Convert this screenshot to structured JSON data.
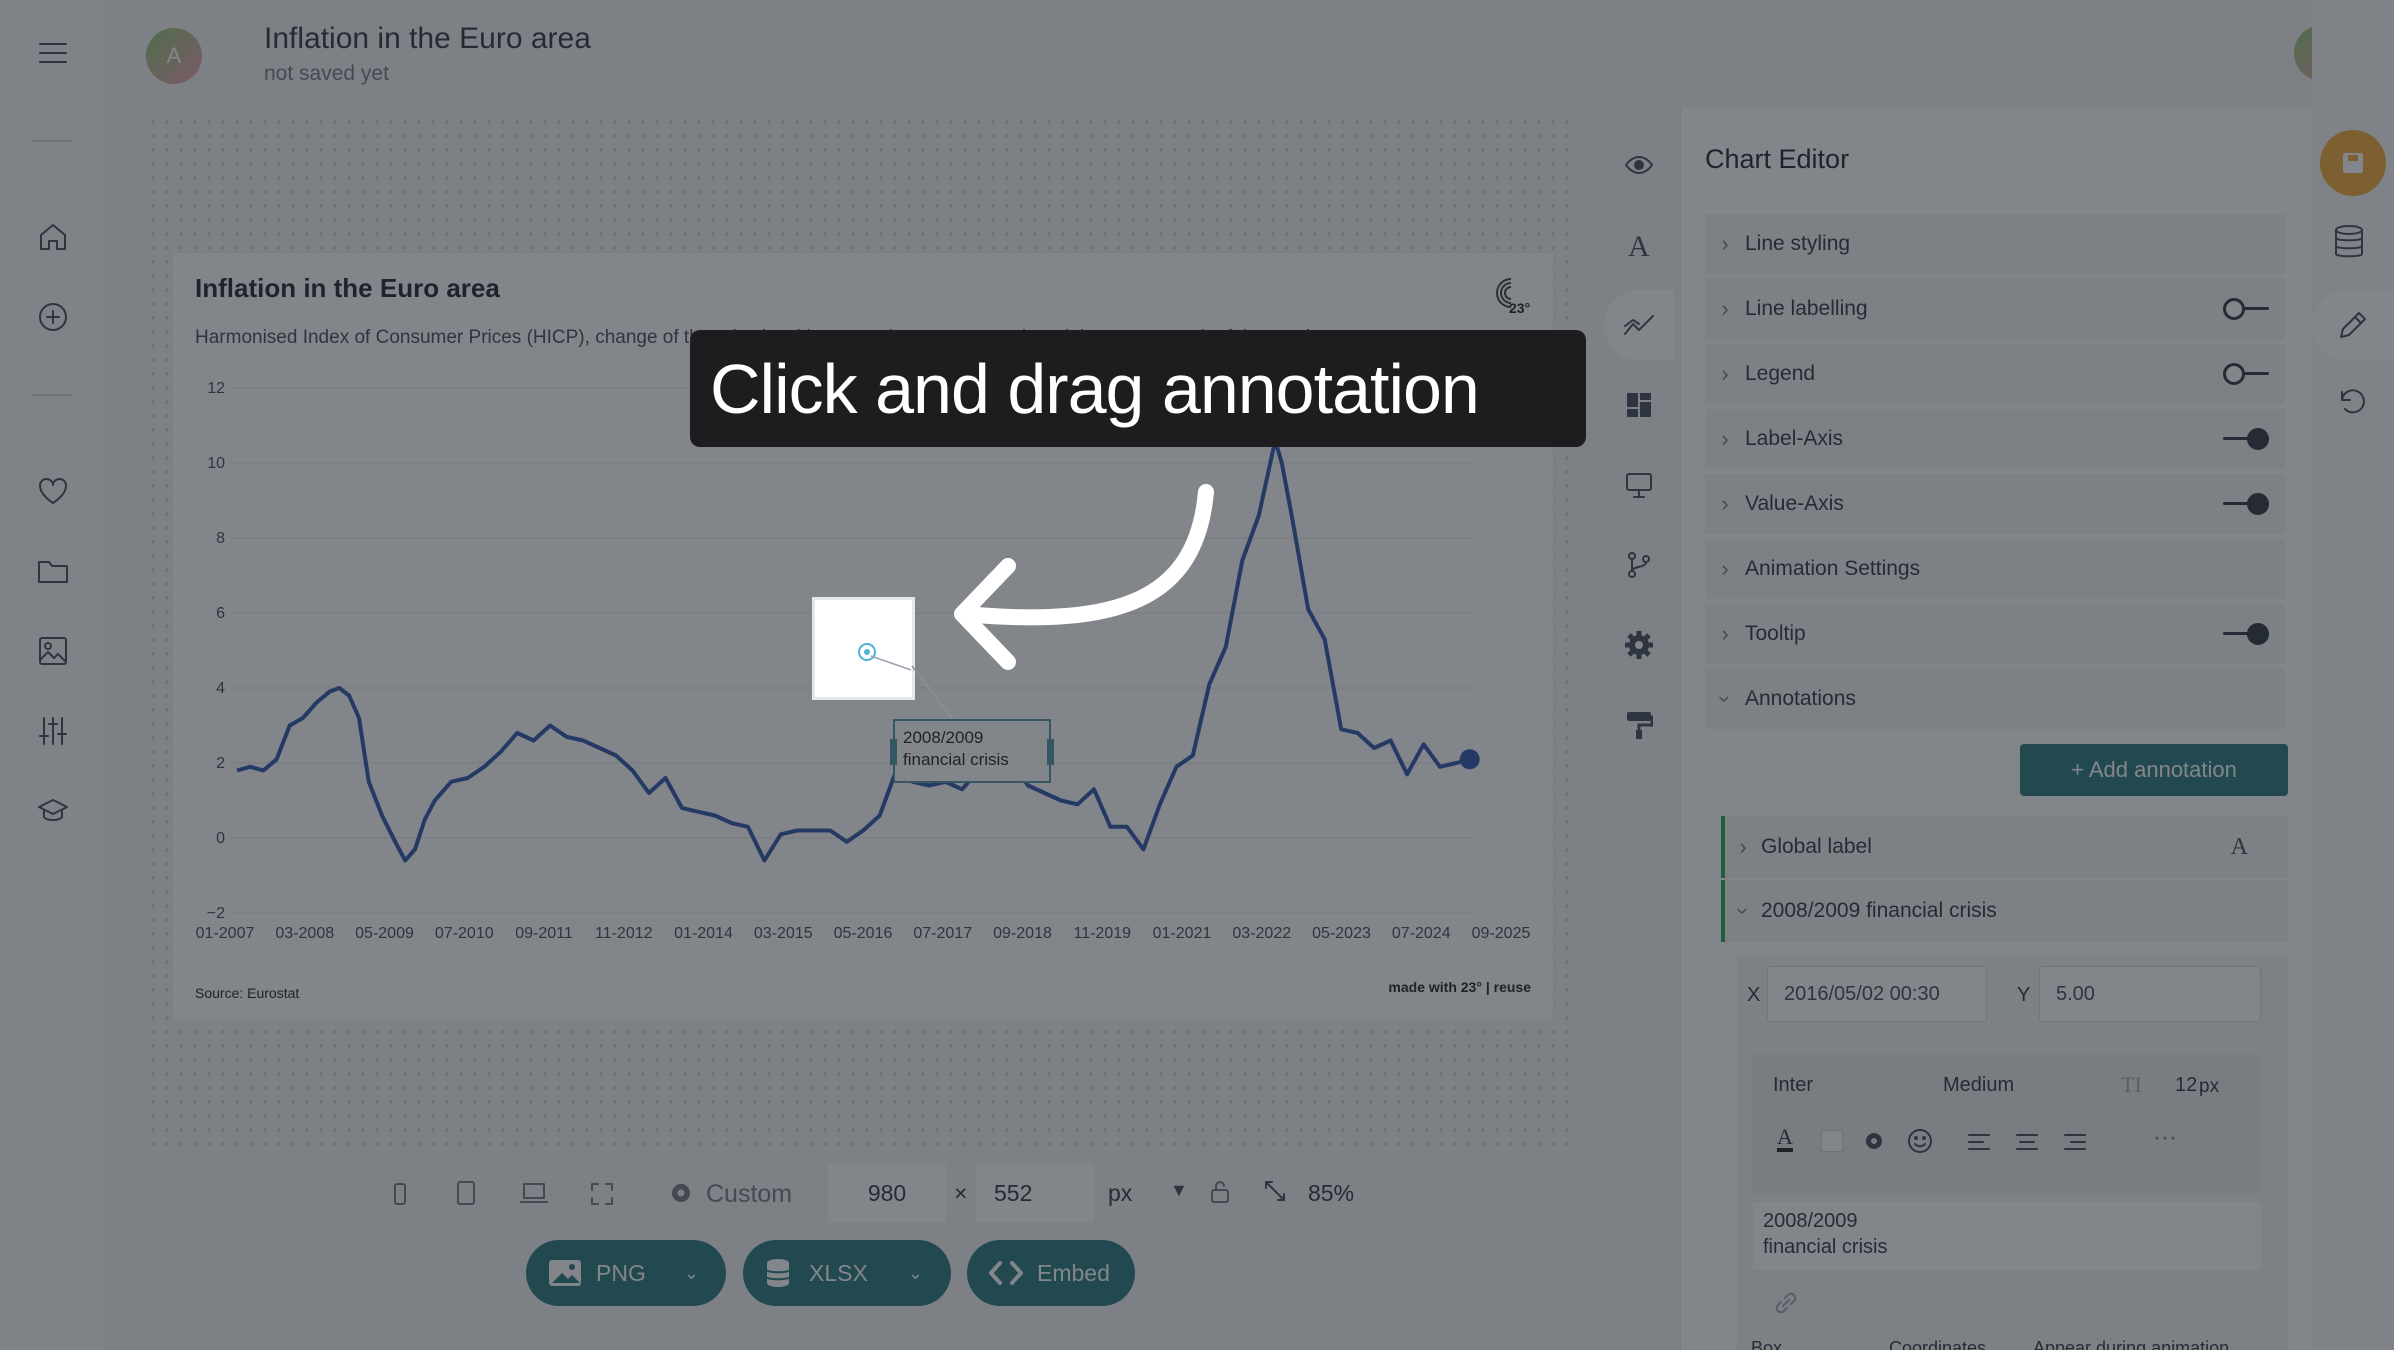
{
  "app": {
    "title": "Inflation in the Euro area",
    "subtitle": "not saved yet",
    "user_initial": "A"
  },
  "left_nav": {
    "items": [
      {
        "name": "menu-icon"
      },
      {
        "name": "home-icon"
      },
      {
        "name": "add-circle-icon"
      },
      {
        "name": "heart-icon"
      },
      {
        "name": "folder-icon"
      },
      {
        "name": "image-icon"
      },
      {
        "name": "sliders-icon"
      },
      {
        "name": "graduation-cap-icon"
      }
    ]
  },
  "chart": {
    "logo_text": "23°",
    "footer_source": "Source: Eurostat",
    "footer_credit": "made with 23° | reuse",
    "annotation_text_line1": "2008/2009",
    "annotation_text_line2": "financial crisis"
  },
  "chart_data": {
    "type": "line",
    "title": "Inflation in the Euro area",
    "subtitle": "Harmonised Index of Consumer Prices (HICP), change of the price level between the current month and the same month of the previous year",
    "xlabel": "",
    "ylabel": "",
    "ylim": [
      -2,
      12
    ],
    "yticks": [
      "12",
      "10",
      "8",
      "6",
      "4",
      "2",
      "0",
      "−2"
    ],
    "xticks": [
      "01-2007",
      "03-2008",
      "05-2009",
      "07-2010",
      "09-2011",
      "11-2012",
      "01-2014",
      "03-2015",
      "05-2016",
      "07-2017",
      "09-2018",
      "11-2019",
      "01-2021",
      "03-2022",
      "05-2023",
      "07-2024",
      "09-2025"
    ],
    "series": [
      {
        "color": "#1f4ea8",
        "x": [
          2007.0,
          2007.2,
          2007.4,
          2007.6,
          2007.8,
          2008.0,
          2008.2,
          2008.4,
          2008.55,
          2008.7,
          2008.85,
          2009.0,
          2009.2,
          2009.4,
          2009.55,
          2009.7,
          2009.85,
          2010.0,
          2010.25,
          2010.5,
          2010.75,
          2011.0,
          2011.25,
          2011.5,
          2011.75,
          2012.0,
          2012.25,
          2012.5,
          2012.75,
          2013.0,
          2013.25,
          2013.5,
          2013.75,
          2014.0,
          2014.25,
          2014.5,
          2014.75,
          2015.0,
          2015.25,
          2015.5,
          2015.75,
          2016.0,
          2016.25,
          2016.5,
          2016.75,
          2017.0,
          2017.25,
          2017.5,
          2017.75,
          2018.0,
          2018.25,
          2018.5,
          2018.75,
          2019.0,
          2019.25,
          2019.5,
          2019.75,
          2020.0,
          2020.25,
          2020.5,
          2020.75,
          2021.0,
          2021.25,
          2021.5,
          2021.75,
          2022.0,
          2022.25,
          2022.5,
          2022.75,
          2022.85,
          2023.0,
          2023.25,
          2023.5,
          2023.75,
          2024.0,
          2024.25,
          2024.5,
          2024.75,
          2025.0,
          2025.25,
          2025.5,
          2025.7
        ],
        "y": [
          1.8,
          1.9,
          1.8,
          2.1,
          3.0,
          3.2,
          3.6,
          3.9,
          4.0,
          3.8,
          3.2,
          1.5,
          0.6,
          -0.1,
          -0.6,
          -0.3,
          0.5,
          1.0,
          1.5,
          1.6,
          1.9,
          2.3,
          2.8,
          2.6,
          3.0,
          2.7,
          2.6,
          2.4,
          2.2,
          1.8,
          1.2,
          1.6,
          0.8,
          0.7,
          0.6,
          0.4,
          0.3,
          -0.6,
          0.1,
          0.2,
          0.2,
          0.2,
          -0.1,
          0.2,
          0.6,
          1.8,
          1.5,
          1.4,
          1.5,
          1.3,
          1.8,
          2.1,
          2.0,
          1.4,
          1.2,
          1.0,
          0.9,
          1.3,
          0.3,
          0.3,
          -0.3,
          0.9,
          1.9,
          2.2,
          4.1,
          5.1,
          7.4,
          8.6,
          10.6,
          10.0,
          8.6,
          6.1,
          5.3,
          2.9,
          2.8,
          2.4,
          2.6,
          1.7,
          2.5,
          1.9,
          2.0,
          2.1
        ]
      }
    ]
  },
  "tool_col": {
    "items": [
      {
        "name": "preview-eye-icon"
      },
      {
        "name": "typography-icon"
      },
      {
        "name": "chart-line-icon"
      },
      {
        "name": "layout-icon"
      },
      {
        "name": "device-icon"
      },
      {
        "name": "branch-icon"
      },
      {
        "name": "settings-gear-icon"
      },
      {
        "name": "paint-roller-icon"
      }
    ]
  },
  "editor": {
    "title": "Chart Editor",
    "sections": [
      {
        "label": "Line styling",
        "toggle": "none"
      },
      {
        "label": "Line labelling",
        "toggle": "off"
      },
      {
        "label": "Legend",
        "toggle": "off"
      },
      {
        "label": "Label-Axis",
        "toggle": "on"
      },
      {
        "label": "Value-Axis",
        "toggle": "on"
      },
      {
        "label": "Animation Settings",
        "toggle": "none"
      },
      {
        "label": "Tooltip",
        "toggle": "on"
      },
      {
        "label": "Annotations",
        "toggle": "none"
      }
    ],
    "add_annotation_label": "+ Add annotation",
    "global_label": "Global label",
    "annotation_name": "2008/2009 financial crisis",
    "x_label": "X",
    "x_value": "2016/05/02 00:30",
    "y_label": "Y",
    "y_value": "5.00",
    "font_family": "Inter",
    "font_weight": "Medium",
    "font_size": "12",
    "font_unit": "px",
    "text_content_line1": "2008/2009",
    "text_content_line2": "financial crisis",
    "footer_tabs": [
      "Box",
      "Coordinates",
      "Appear during animation"
    ]
  },
  "bottom": {
    "preset": "Custom",
    "width": "980",
    "height": "552",
    "times": "×",
    "unit": "px",
    "zoom": "85%",
    "png_label": "PNG",
    "xlsx_label": "XLSX",
    "embed_label": "Embed"
  },
  "tutorial": {
    "message": "Click and drag annotation"
  },
  "colors": {
    "accent": "#1c6f78",
    "line": "#1f4ea8",
    "save_button": "#f0a830"
  }
}
